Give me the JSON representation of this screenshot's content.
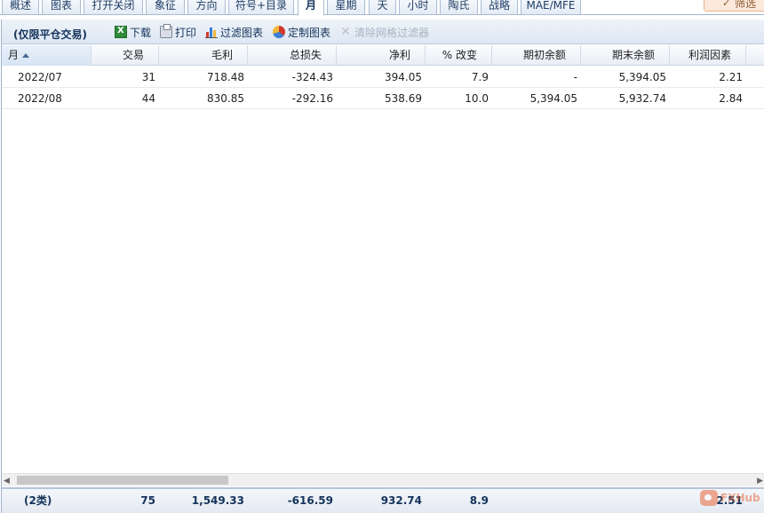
{
  "tabs": [
    "概述",
    "图表",
    "打开关闭",
    "象征",
    "方向",
    "符号+目录",
    "月",
    "星期",
    "天",
    "小时",
    "陶氏",
    "战略",
    "MAE/MFE"
  ],
  "active_tab": "月",
  "filter_button": {
    "label": "筛选",
    "icon": "check-icon"
  },
  "toolbar": {
    "title": "(仅限平仓交易)",
    "download": "下载",
    "print": "打印",
    "filter_chart": "过滤图表",
    "custom_chart": "定制图表",
    "clear_grid_filter": "清除网格过滤器"
  },
  "columns": [
    "月",
    "交易",
    "毛利",
    "总损失",
    "净利",
    "% 改变",
    "期初余额",
    "期末余额",
    "利润因素"
  ],
  "rows": [
    {
      "month": "2022/07",
      "trades": "31",
      "gross_profit": "718.48",
      "gross_loss": "-324.43",
      "net_profit": "394.05",
      "pct_change": "7.9",
      "start_balance": "-",
      "end_balance": "5,394.05",
      "profit_factor": "2.21"
    },
    {
      "month": "2022/08",
      "trades": "44",
      "gross_profit": "830.85",
      "gross_loss": "-292.16",
      "net_profit": "538.69",
      "pct_change": "10.0",
      "start_balance": "5,394.05",
      "end_balance": "5,932.74",
      "profit_factor": "2.84"
    }
  ],
  "footer": {
    "label": "(2类)",
    "trades": "75",
    "gross_profit": "1,549.33",
    "gross_loss": "-616.59",
    "net_profit": "932.74",
    "pct_change": "8.9",
    "start_balance": "",
    "end_balance": "",
    "profit_factor": "2.51"
  },
  "watermark": "FXHub",
  "colors": {
    "accent": "#15335b",
    "border": "#9fb4cf",
    "filter_bg": "#fde9dc"
  }
}
